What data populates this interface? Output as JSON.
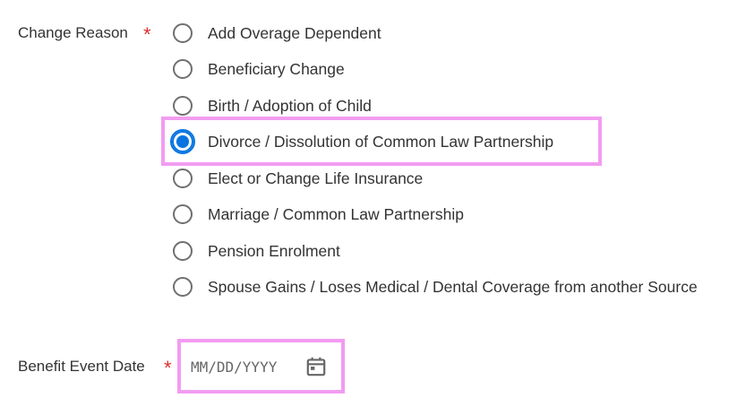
{
  "change_reason": {
    "label": "Change Reason",
    "required_mark": "*",
    "selected": "Divorce / Dissolution of Common Law Partnership",
    "options": [
      {
        "label": "Add Overage Dependent"
      },
      {
        "label": "Beneficiary Change"
      },
      {
        "label": "Birth / Adoption of Child"
      },
      {
        "label": "Divorce / Dissolution of Common Law Partnership"
      },
      {
        "label": "Elect or Change Life Insurance"
      },
      {
        "label": "Marriage / Common Law Partnership"
      },
      {
        "label": "Pension Enrolment"
      },
      {
        "label": "Spouse Gains / Loses Medical / Dental Coverage from another Source"
      }
    ]
  },
  "benefit_event_date": {
    "label": "Benefit Event Date",
    "required_mark": "*",
    "placeholder": "MM/DD/YYYY",
    "value": ""
  },
  "icons": {
    "calendar": "calendar-icon"
  },
  "colors": {
    "accent": "#0875e1",
    "required": "#de2f2f",
    "highlight": "#f29cf1",
    "text": "#333333"
  }
}
